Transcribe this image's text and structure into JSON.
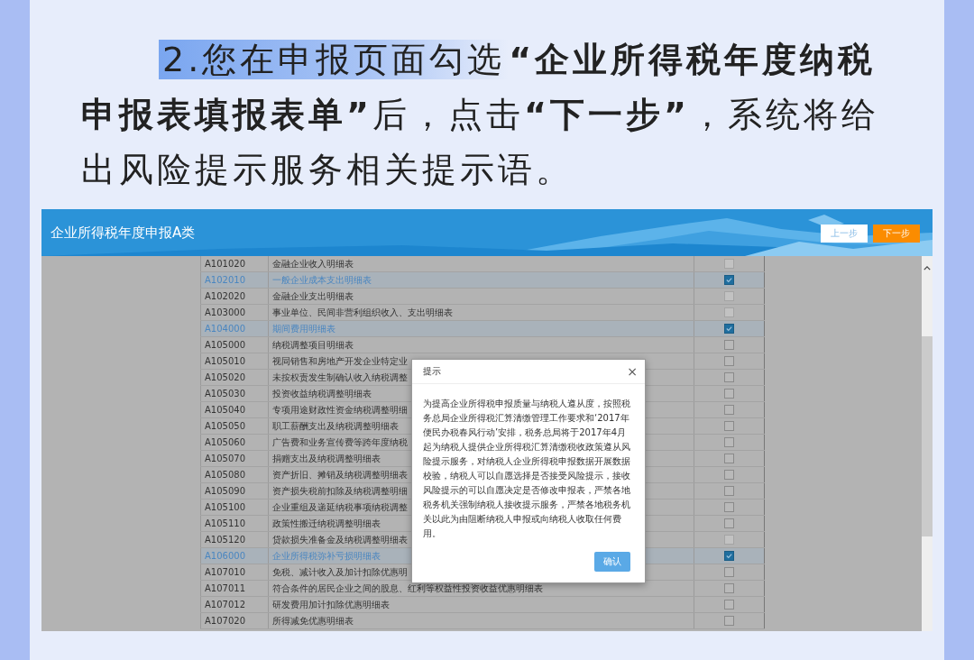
{
  "heading": {
    "highlight": "2.您在申报页面勾选",
    "text": "**“企业所得税年度纳税申报表填报表单”**后，点击**“下一步”**，系统将给出风险提示服务相关提示语。"
  },
  "app": {
    "title": "企业所得税年度申报A类",
    "buttons": [
      {
        "label": "上一步",
        "kind": "secondary"
      },
      {
        "label": "下一步",
        "kind": "primary"
      }
    ]
  },
  "table": {
    "rows": [
      {
        "code": "A101020",
        "name": "金融企业收入明细表",
        "selected": false,
        "disabled": true
      },
      {
        "code": "A102010",
        "name": "一般企业成本支出明细表",
        "selected": true,
        "disabled": false
      },
      {
        "code": "A102020",
        "name": "金融企业支出明细表",
        "selected": false,
        "disabled": true
      },
      {
        "code": "A103000",
        "name": "事业单位、民间非营利组织收入、支出明细表",
        "selected": false,
        "disabled": true
      },
      {
        "code": "A104000",
        "name": "期间费用明细表",
        "selected": true,
        "disabled": false
      },
      {
        "code": "A105000",
        "name": "纳税调整项目明细表",
        "selected": false,
        "disabled": false
      },
      {
        "code": "A105010",
        "name": "视同销售和房地产开发企业特定业",
        "selected": false,
        "disabled": false
      },
      {
        "code": "A105020",
        "name": "未按权责发生制确认收入纳税调整",
        "selected": false,
        "disabled": false
      },
      {
        "code": "A105030",
        "name": "投资收益纳税调整明细表",
        "selected": false,
        "disabled": false
      },
      {
        "code": "A105040",
        "name": "专项用途财政性资金纳税调整明细",
        "selected": false,
        "disabled": false
      },
      {
        "code": "A105050",
        "name": "职工薪酬支出及纳税调整明细表",
        "selected": false,
        "disabled": false
      },
      {
        "code": "A105060",
        "name": "广告费和业务宣传费等跨年度纳税",
        "selected": false,
        "disabled": false
      },
      {
        "code": "A105070",
        "name": "捐赠支出及纳税调整明细表",
        "selected": false,
        "disabled": false
      },
      {
        "code": "A105080",
        "name": "资产折旧、摊销及纳税调整明细表",
        "selected": false,
        "disabled": false
      },
      {
        "code": "A105090",
        "name": "资产损失税前扣除及纳税调整明细",
        "selected": false,
        "disabled": false
      },
      {
        "code": "A105100",
        "name": "企业重组及递延纳税事项纳税调整",
        "selected": false,
        "disabled": false
      },
      {
        "code": "A105110",
        "name": "政策性搬迁纳税调整明细表",
        "selected": false,
        "disabled": false
      },
      {
        "code": "A105120",
        "name": "贷款损失准备金及纳税调整明细表",
        "selected": false,
        "disabled": true
      },
      {
        "code": "A106000",
        "name": "企业所得税弥补亏损明细表",
        "selected": true,
        "disabled": false
      },
      {
        "code": "A107010",
        "name": "免税、减计收入及加计扣除优惠明",
        "selected": false,
        "disabled": false
      },
      {
        "code": "A107011",
        "name": "符合条件的居民企业之间的股息、红利等权益性投资收益优惠明细表",
        "selected": false,
        "disabled": false
      },
      {
        "code": "A107012",
        "name": "研发费用加计扣除优惠明细表",
        "selected": false,
        "disabled": false
      },
      {
        "code": "A107020",
        "name": "所得减免优惠明细表",
        "selected": false,
        "disabled": false
      }
    ]
  },
  "dialog": {
    "title": "提示",
    "close": "×",
    "body": "为提高企业所得税申报质量与纳税人遵从度，按照税务总局企业所得税汇算清缴管理工作要求和‘2017年便民办税春风行动’安排，税务总局将于2017年4月起为纳税人提供企业所得税汇算清缴税收政策遵从风险提示服务，对纳税人企业所得税申报数据开展数据校验，纳税人可以自愿选择是否接受风险提示，接收风险提示的可以自愿决定是否修改申报表，严禁各地税务机关强制纳税人接收提示服务，严禁各地税务机关以此为由阻断纳税人申报或向纳税人收取任何费用。",
    "button": "确认"
  }
}
